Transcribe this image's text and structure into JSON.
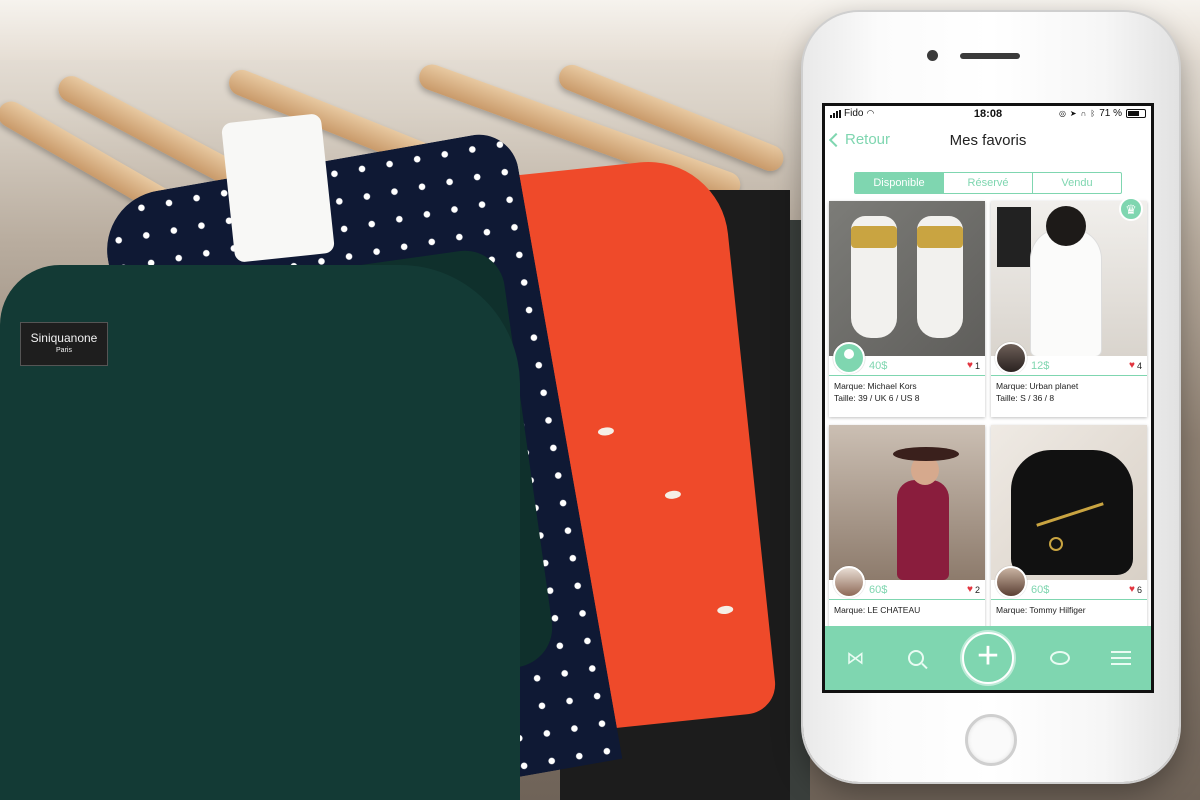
{
  "status_bar": {
    "carrier": "Fido",
    "time": "18:08",
    "battery": "71 %",
    "battery_level": 0.71
  },
  "nav": {
    "back_label": "Retour",
    "title": "Mes favoris"
  },
  "segments": [
    {
      "label": "Disponible",
      "active": true
    },
    {
      "label": "Réservé",
      "active": false
    },
    {
      "label": "Vendu",
      "active": false
    }
  ],
  "products": [
    {
      "price": "40$",
      "likes": "1",
      "brand": "Marque: Michael Kors",
      "size": "Taille: 39 / UK 6 / US 8",
      "photo": "sneakers",
      "premium": false
    },
    {
      "price": "12$",
      "likes": "4",
      "brand": "Marque: Urban planet",
      "size": "Taille: S / 36 / 8",
      "photo": "white-jumpsuit",
      "premium": true
    },
    {
      "price": "60$",
      "likes": "2",
      "brand": "Marque: LE CHATEAU",
      "size": "",
      "photo": "burgundy-dress",
      "premium": false
    },
    {
      "price": "60$",
      "likes": "6",
      "brand": "Marque: Tommy Hilfiger",
      "size": "",
      "photo": "black-backpack",
      "premium": false
    }
  ],
  "tabbar": {
    "icons": [
      "bowtie-icon",
      "search-icon",
      "add-icon",
      "chat-icon",
      "menu-icon"
    ],
    "add_glyph": "+"
  },
  "background": {
    "clothing_label_brand": "Siniquanone",
    "clothing_label_city": "Paris"
  },
  "colors": {
    "accent": "#7fd6b0",
    "heart": "#e2343f"
  }
}
